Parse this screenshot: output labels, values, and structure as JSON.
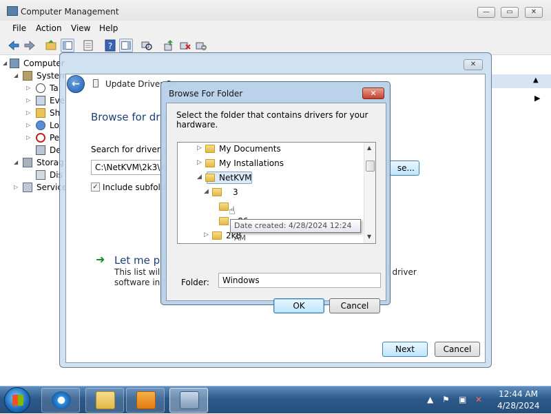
{
  "window": {
    "title": "Computer Management",
    "controls": {
      "minimize": "—",
      "maximize": "▭",
      "close": "✕"
    }
  },
  "menu": [
    "File",
    "Action",
    "View",
    "Help"
  ],
  "toolbar": {
    "icons": [
      "back-arrow-icon",
      "forward-arrow-icon",
      "up-folder-icon",
      "show-hide-tree-icon",
      "properties-icon",
      "help-icon",
      "show-hide-action-pane-icon",
      "scan-hardware-icon",
      "update-driver-icon",
      "uninstall-icon",
      "disable-device-icon"
    ]
  },
  "tree": {
    "items": [
      {
        "label": "Computer",
        "level": 0
      },
      {
        "label": "System",
        "level": 1
      },
      {
        "label": "Ta",
        "level": 2
      },
      {
        "label": "Eve",
        "level": 2
      },
      {
        "label": "Sh",
        "level": 2
      },
      {
        "label": "Lo",
        "level": 2
      },
      {
        "label": "Pe",
        "level": 2
      },
      {
        "label": "De",
        "level": 2
      },
      {
        "label": "Storag",
        "level": 1
      },
      {
        "label": "Dis",
        "level": 2
      },
      {
        "label": "Service",
        "level": 1
      }
    ]
  },
  "update_dialog": {
    "title": "Update Driver So",
    "close_label": "✕",
    "heading": "Browse for driv",
    "search_label": "Search for driver so",
    "path_value": "C:\\NetKVM\\2k3\\x8",
    "browse_label": "se...",
    "include_subfolders": "Include subfolde",
    "let_me_pick": "Let me pic",
    "desc_line1": "This list will s",
    "desc_line2": "software in th",
    "desc_right": "ll driver",
    "next_label": "Next",
    "cancel_label": "Cancel"
  },
  "browse_dialog": {
    "title": "Browse For Folder",
    "close_label": "✕",
    "instruction": "Select the folder that contains drivers for your hardware.",
    "folders": [
      {
        "name": "My Documents",
        "expander": "▷"
      },
      {
        "name": "My Installations",
        "expander": "▷"
      },
      {
        "name": "NetKVM",
        "expander": "◢"
      },
      {
        "name": "3",
        "expander": "◢"
      },
      {
        "name": "",
        "expander": ""
      },
      {
        "name": "x86",
        "expander": ""
      },
      {
        "name": "2k8",
        "expander": "▷"
      }
    ],
    "tooltip": "Date created: 4/28/2024 12:24 AM",
    "folder_label": "Folder:",
    "folder_value": "Windows",
    "ok_label": "OK",
    "cancel_label": "Cancel"
  },
  "taskbar": {
    "apps": [
      "internet-explorer-icon",
      "file-explorer-icon",
      "media-player-icon",
      "computer-management-icon"
    ],
    "time": "12:44 AM",
    "date": "4/28/2024"
  }
}
